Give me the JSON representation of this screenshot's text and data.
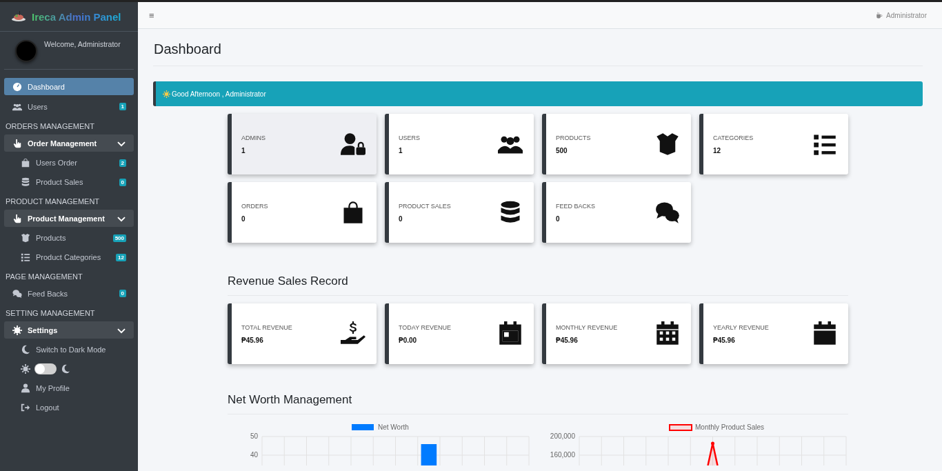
{
  "sidebar": {
    "brand": "Ireca Admin Panel",
    "welcome": "Welcome, Administrator",
    "items": [
      {
        "kind": "link",
        "label": "Dashboard",
        "selected": true
      },
      {
        "kind": "link",
        "label": "Users",
        "badge": "1",
        "selected": false
      },
      {
        "kind": "header",
        "label": "ORDERS MANAGEMENT"
      },
      {
        "kind": "group",
        "label": "Order Management",
        "expanded": true,
        "children": [
          {
            "kind": "sublink",
            "label": "Users Order",
            "badge": "2",
            "selected": false
          },
          {
            "kind": "sublink",
            "label": "Product Sales",
            "badge": "0",
            "selected": false
          }
        ]
      },
      {
        "kind": "header",
        "label": "PRODUCT MANAGEMENT"
      },
      {
        "kind": "group",
        "label": "Product Management",
        "expanded": true,
        "children": [
          {
            "kind": "sublink",
            "label": "Products",
            "badge": "500",
            "selected": false
          },
          {
            "kind": "sublink",
            "label": "Product Categories",
            "badge": "12",
            "selected": false
          }
        ]
      },
      {
        "kind": "header",
        "label": "PAGE MANAGEMENT"
      },
      {
        "kind": "link",
        "label": "Feed Backs",
        "badge": "0",
        "selected": false
      },
      {
        "kind": "header",
        "label": "SETTING MANAGEMENT"
      },
      {
        "kind": "group",
        "label": "Settings",
        "expanded": true,
        "children": [
          {
            "kind": "sublink",
            "label": "Switch to Dark Mode",
            "selected": false
          },
          {
            "kind": "toggle",
            "on": false
          },
          {
            "kind": "sublink",
            "label": "My Profile",
            "selected": false
          },
          {
            "kind": "sublink",
            "label": "Logout",
            "selected": false
          }
        ]
      }
    ]
  },
  "topbar": {
    "menu_glyph": "≡",
    "user": "Administrator"
  },
  "page_title": "Dashboard",
  "greeting": "Good Afternoon , Administrator",
  "stat_cards": [
    {
      "label": "ADMINS",
      "value": "1",
      "hovered": true
    },
    {
      "label": "USERS",
      "value": "1",
      "hovered": false
    },
    {
      "label": "PRODUCTS",
      "value": "500",
      "hovered": false
    },
    {
      "label": "CATEGORIES",
      "value": "12",
      "hovered": false
    },
    {
      "label": "ORDERS",
      "value": "0",
      "hovered": false
    },
    {
      "label": "PRODUCT SALES",
      "value": "0",
      "hovered": false
    },
    {
      "label": "FEED BACKS",
      "value": "0",
      "hovered": false
    }
  ],
  "revenue_title": "Revenue Sales Record",
  "revenue_cards": [
    {
      "label": "TOTAL REVENUE",
      "value": "₱45.96"
    },
    {
      "label": "TODAY REVENUE",
      "value": "₱0.00"
    },
    {
      "label": "MONTHLY REVENUE",
      "value": "₱45.96"
    },
    {
      "label": "YEARLY REVENUE",
      "value": "₱45.96"
    }
  ],
  "networth_title": "Net Worth Management",
  "charts": [
    {
      "kind": "bar",
      "legend": "Net Worth",
      "color": "#007bff",
      "y_tick_labels": [
        "50",
        "40"
      ]
    },
    {
      "kind": "line",
      "legend": "Monthly Product Sales",
      "color": "#ff0000",
      "y_tick_labels": [
        "200,000",
        "160,000"
      ]
    }
  ]
}
